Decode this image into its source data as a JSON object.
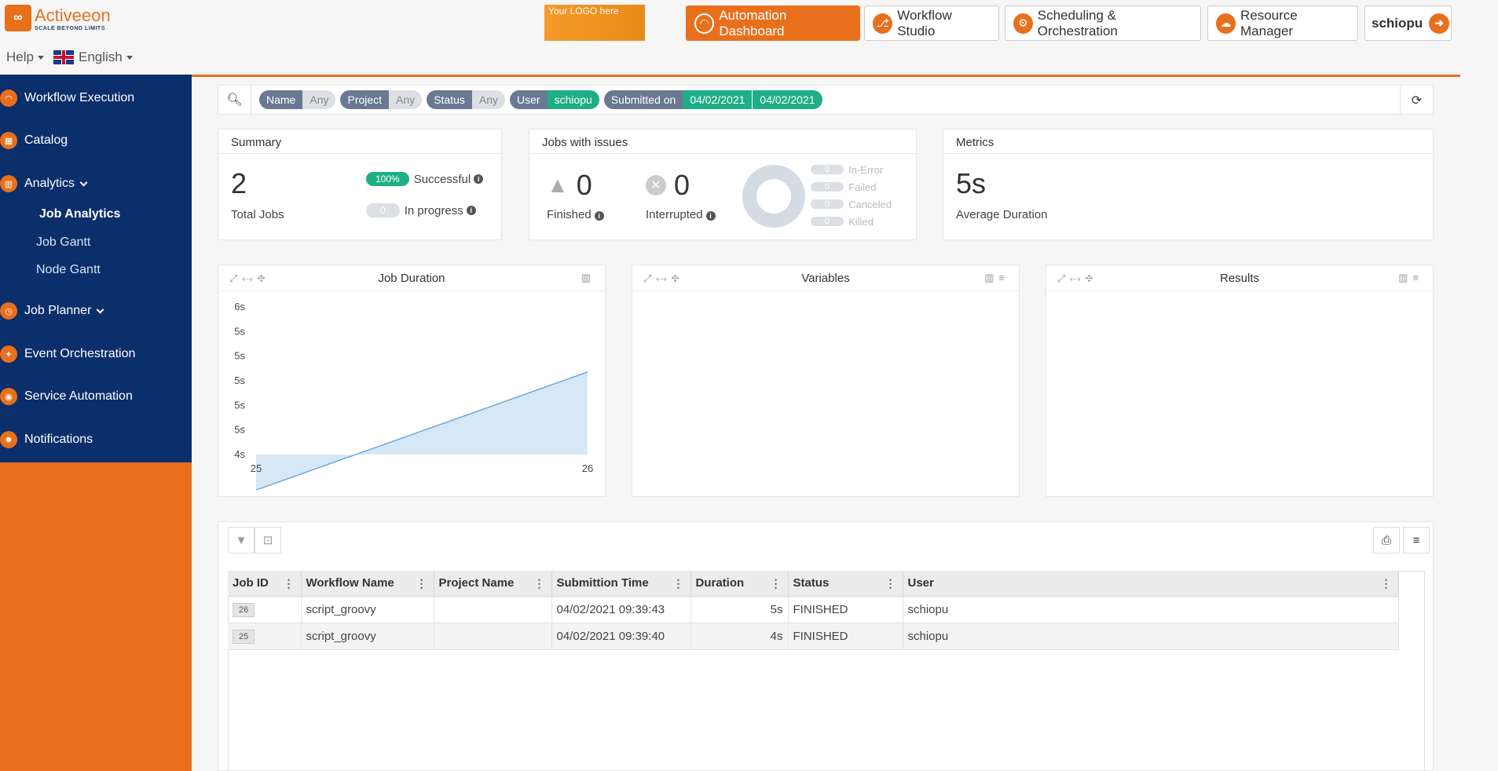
{
  "brand": {
    "name": "Activeeon",
    "tagline": "SCALE BEYOND LIMITS"
  },
  "header": {
    "help": "Help",
    "language": "English",
    "logo_placeholder": "Your LOGO here",
    "nav": [
      {
        "label": "Automation Dashboard",
        "icon": "speedometer-icon",
        "active": true
      },
      {
        "label": "Workflow Studio",
        "icon": "workflow-icon",
        "active": false
      },
      {
        "label": "Scheduling & Orchestration",
        "icon": "gears-icon",
        "active": false
      },
      {
        "label": "Resource Manager",
        "icon": "cloud-icon",
        "active": false
      }
    ],
    "user": "schiopu"
  },
  "sidebar": {
    "items": [
      {
        "label": "Workflow Execution"
      },
      {
        "label": "Catalog"
      },
      {
        "label": "Analytics",
        "expanded": true
      },
      {
        "label": "Job Planner",
        "expanded": true
      },
      {
        "label": "Event Orchestration"
      },
      {
        "label": "Service Automation"
      },
      {
        "label": "Notifications"
      }
    ],
    "analytics_sub": [
      "Job Analytics",
      "Job Gantt",
      "Node Gantt"
    ],
    "active_sub": "Job Analytics"
  },
  "filters": [
    {
      "key": "Name",
      "value": "Any",
      "set": false
    },
    {
      "key": "Project",
      "value": "Any",
      "set": false
    },
    {
      "key": "Status",
      "value": "Any",
      "set": false
    },
    {
      "key": "User",
      "value": "schiopu",
      "set": true
    },
    {
      "key": "Submitted on",
      "value": "04/02/2021",
      "value2": "04/02/2021",
      "set": true
    }
  ],
  "summary": {
    "title": "Summary",
    "total": "2",
    "total_label": "Total Jobs",
    "success_pct": "100%",
    "success_label": "Successful",
    "progress": "0",
    "progress_label": "In progress"
  },
  "issues": {
    "title": "Jobs with issues",
    "finished": "0",
    "finished_label": "Finished",
    "interrupted": "0",
    "interrupted_label": "Interrupted",
    "legend": [
      {
        "count": "0",
        "label": "In-Error"
      },
      {
        "count": "0",
        "label": "Failed"
      },
      {
        "count": "0",
        "label": "Canceled"
      },
      {
        "count": "0",
        "label": "Killed"
      }
    ]
  },
  "metrics": {
    "title": "Metrics",
    "avg": "5s",
    "avg_label": "Average Duration"
  },
  "charts": {
    "duration_title": "Job Duration",
    "variables_title": "Variables",
    "results_title": "Results"
  },
  "chart_data": {
    "type": "area",
    "title": "Job Duration",
    "x": [
      "25",
      "26"
    ],
    "values": [
      4,
      5
    ],
    "y_tick_labels": [
      "6s",
      "5s",
      "5s",
      "5s",
      "5s",
      "5s",
      "4s"
    ],
    "ylim": [
      4.3,
      5.55
    ],
    "fill_color": "#d6e7f5",
    "line_color": "#5d9fd6"
  },
  "table": {
    "columns": [
      "Job ID",
      "Workflow Name",
      "Project Name",
      "Submittion Time",
      "Duration",
      "Status",
      "User"
    ],
    "rows": [
      {
        "id": "26",
        "workflow": "script_groovy",
        "project": "",
        "time": "04/02/2021 09:39:43",
        "duration": "5s",
        "status": "FINISHED",
        "user": "schiopu"
      },
      {
        "id": "25",
        "workflow": "script_groovy",
        "project": "",
        "time": "04/02/2021 09:39:40",
        "duration": "4s",
        "status": "FINISHED",
        "user": "schiopu"
      }
    ]
  },
  "colors": {
    "accent": "#e8701d",
    "sidebar": "#0b2f6b",
    "success": "#1fae85"
  }
}
